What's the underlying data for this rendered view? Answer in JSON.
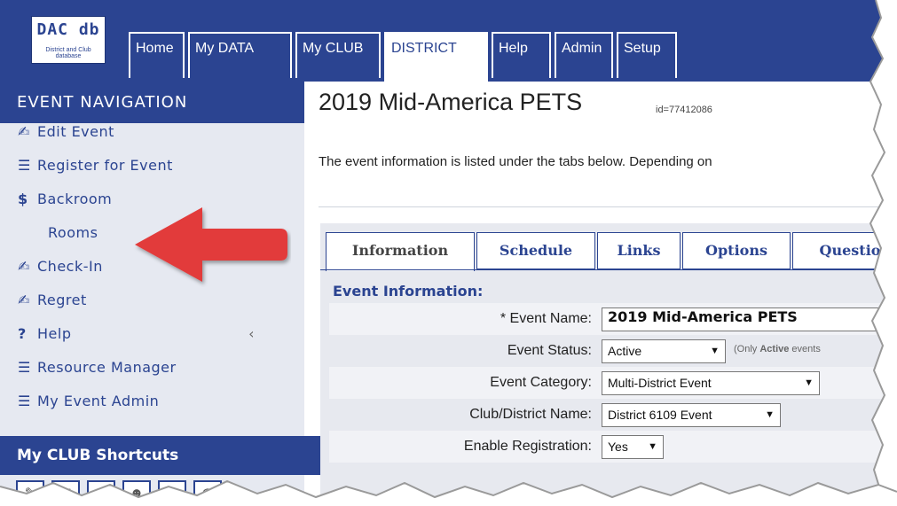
{
  "logo": {
    "title": "DAC db",
    "subtitle": "District and Club database"
  },
  "nav_tabs": [
    "Home",
    "My DATA",
    "My CLUB",
    "DISTRICT",
    "Help",
    "Admin",
    "Setup"
  ],
  "active_tab": "DISTRICT",
  "sidebar": {
    "header": "EVENT NAVIGATION",
    "items": [
      {
        "icon": "edit-icon",
        "glyph": "✍",
        "label": "Edit Event"
      },
      {
        "icon": "list-icon",
        "glyph": "☰",
        "label": "Register for Event"
      },
      {
        "icon": "dollar-icon",
        "glyph": "$",
        "label": "Backroom"
      },
      {
        "icon": "",
        "glyph": "",
        "label": "Rooms"
      },
      {
        "icon": "edit-icon",
        "glyph": "✍",
        "label": "Check-In"
      },
      {
        "icon": "edit-icon",
        "glyph": "✍",
        "label": "Regret"
      },
      {
        "icon": "help-icon",
        "glyph": "?",
        "label": "Help"
      },
      {
        "icon": "list-icon",
        "glyph": "☰",
        "label": "Resource Manager"
      },
      {
        "icon": "list-icon",
        "glyph": "☰",
        "label": "My Event Admin"
      }
    ],
    "help_caret": "‹",
    "shortcuts_header": "My CLUB Shortcuts",
    "shortcuts": [
      "✎",
      "✉",
      "◎",
      "☻",
      "✖",
      "◍"
    ]
  },
  "main": {
    "title": "2019 Mid-America PETS",
    "event_id": "id=77412086",
    "intro": "The event information is listed under the tabs below. Depending on",
    "inner_tabs": [
      "Information",
      "Schedule",
      "Links",
      "Options",
      "Questio"
    ],
    "active_inner_tab": "Information",
    "section_header": "Event Information:",
    "fields": [
      {
        "label": "* Event Name:",
        "value": "2019 Mid-America PETS",
        "type": "text"
      },
      {
        "label": "Event Status:",
        "value": "Active",
        "type": "select",
        "note_pre": "(Only ",
        "note_bold": "Active",
        "note_post": " events"
      },
      {
        "label": "Event Category:",
        "value": "Multi-District Event",
        "type": "select"
      },
      {
        "label": "Club/District Name:",
        "value": "District 6109 Event",
        "type": "select"
      },
      {
        "label": "Enable Registration:",
        "value": "Yes",
        "type": "select"
      }
    ]
  },
  "colors": {
    "brand": "#2b4491",
    "sidebar_bg": "#e6e9f1",
    "arrow": "#e23b3b"
  }
}
